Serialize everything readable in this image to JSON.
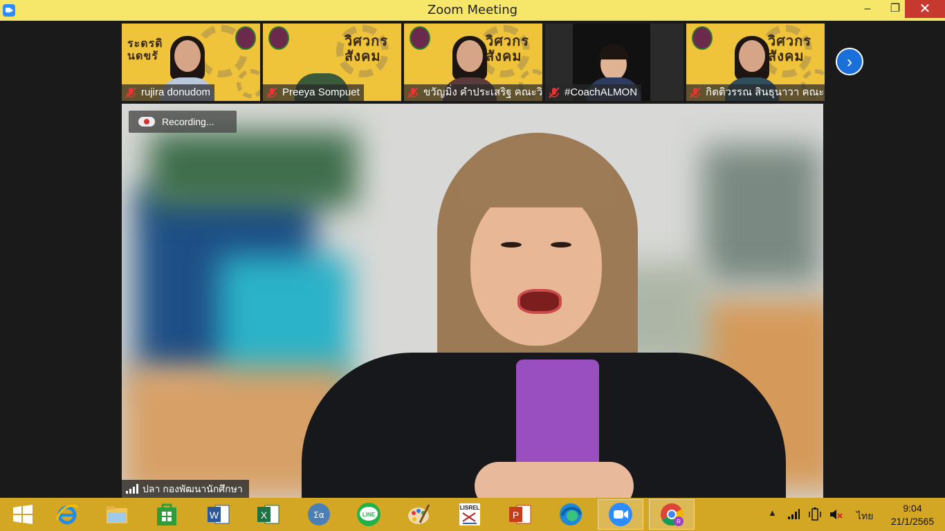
{
  "window": {
    "title": "Zoom Meeting",
    "minimize": "‒",
    "maximize": "❐",
    "close": "✕"
  },
  "thumbnails": [
    {
      "name": "rujira donudom",
      "big_text": "ระดรดิ นดขรั"
    },
    {
      "name": "Preeya Sompuet",
      "big_text": "วิศวกร สังคม"
    },
    {
      "name": "ขวัญมิ่ง คำประเสริฐ คณะวิ...",
      "big_text": "วิศวกร สังคม"
    },
    {
      "name": "#CoachALMON",
      "big_text": ""
    },
    {
      "name": "กิตติวรรณ สินธุนาวา คณะ...",
      "big_text": "วิศวกร สังคม"
    }
  ],
  "next_page_icon": "chevron-right-icon",
  "main_video": {
    "recording_label": "Recording...",
    "speaker_name": "ปลา  กองพัฒนานักศึกษา"
  },
  "taskbar": {
    "items": [
      {
        "name": "start-button",
        "icon": "windows-logo"
      },
      {
        "name": "internet-explorer",
        "icon": "ie-icon"
      },
      {
        "name": "file-explorer",
        "icon": "folder-icon"
      },
      {
        "name": "store",
        "icon": "store-icon"
      },
      {
        "name": "word",
        "icon": "word-icon",
        "label": "W"
      },
      {
        "name": "excel",
        "icon": "excel-icon",
        "label": "X"
      },
      {
        "name": "math-input",
        "icon": "math-icon",
        "label": "Σα"
      },
      {
        "name": "line",
        "icon": "line-icon",
        "label": "LINE"
      },
      {
        "name": "paint",
        "icon": "palette-icon"
      },
      {
        "name": "lisrel",
        "icon": "lisrel-icon",
        "label": "LISREL"
      },
      {
        "name": "powerpoint",
        "icon": "powerpoint-icon",
        "label": "P"
      },
      {
        "name": "edge",
        "icon": "edge-icon"
      },
      {
        "name": "zoom",
        "icon": "zoom-icon"
      },
      {
        "name": "chrome",
        "icon": "chrome-icon",
        "label": "R"
      }
    ],
    "tray": {
      "language": "ไทย",
      "time": "9:04",
      "date": "21/1/2565"
    }
  },
  "colors": {
    "titlebar": "#f6e66a",
    "taskbar": "#d3a624",
    "zoom_blue": "#2d8cff",
    "close_red": "#c7382e"
  }
}
